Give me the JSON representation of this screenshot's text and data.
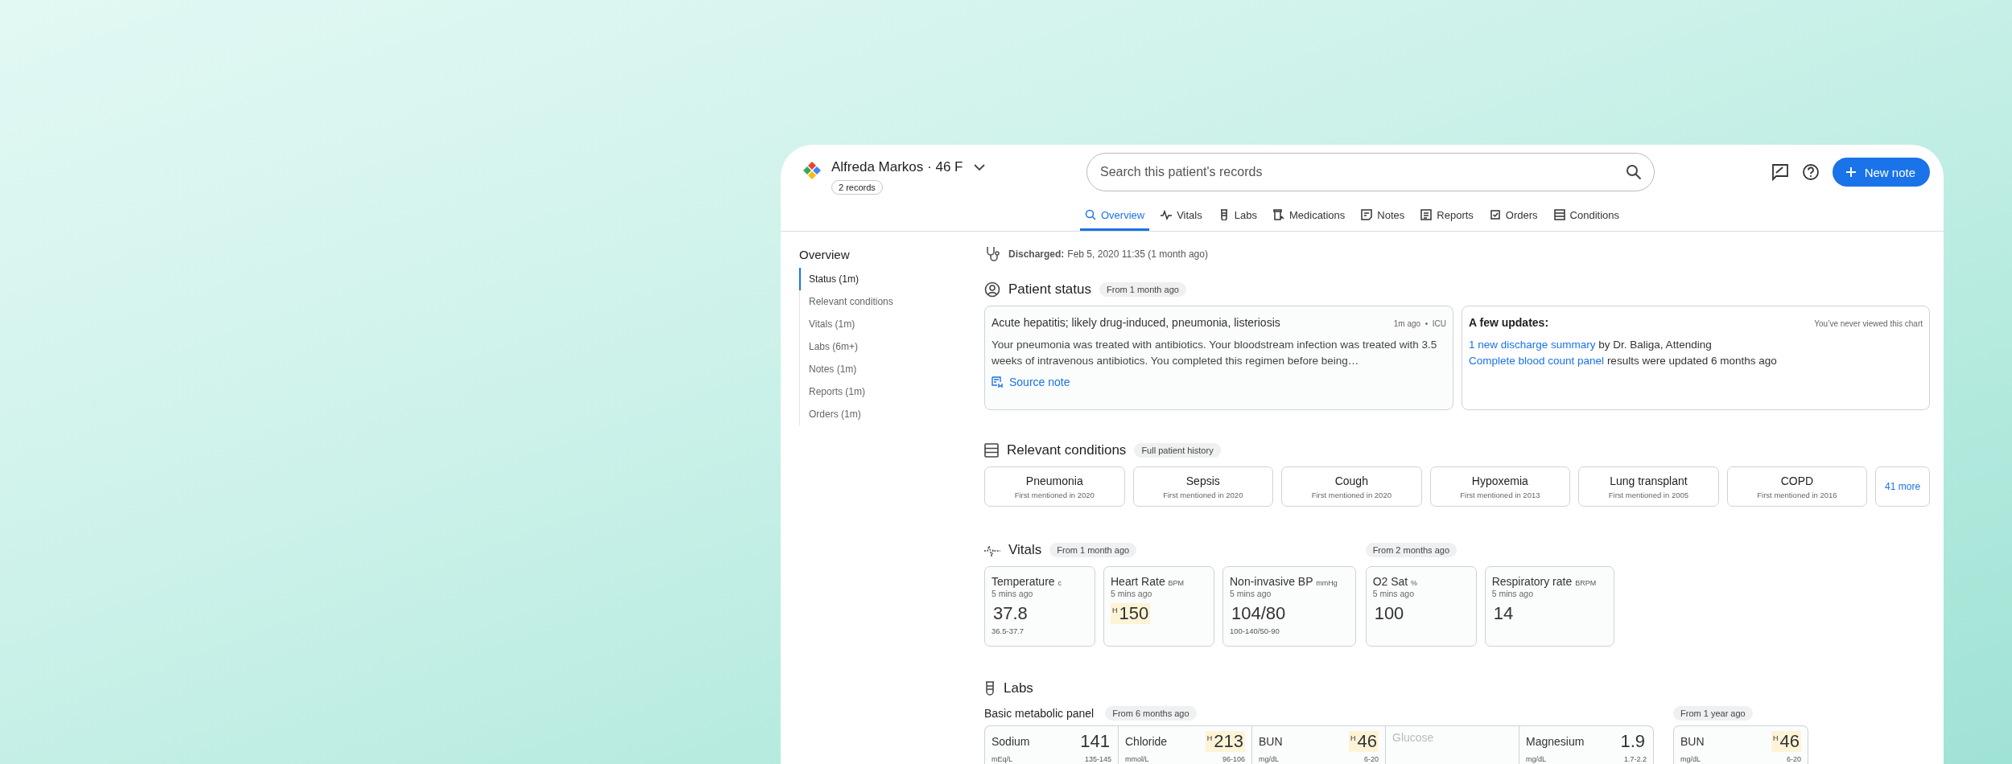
{
  "header": {
    "patient_name": "Alfreda Markos · 46 F",
    "records_badge": "2 records",
    "search": {
      "placeholder": "Search this patient's records"
    },
    "new_note_button": "New note"
  },
  "tabs": [
    {
      "label": "Overview",
      "selected": true
    },
    {
      "label": "Vitals",
      "selected": false
    },
    {
      "label": "Labs",
      "selected": false
    },
    {
      "label": "Medications",
      "selected": false
    },
    {
      "label": "Notes",
      "selected": false
    },
    {
      "label": "Reports",
      "selected": false
    },
    {
      "label": "Orders",
      "selected": false
    },
    {
      "label": "Conditions",
      "selected": false
    }
  ],
  "sidebar": {
    "title": "Overview",
    "items": [
      {
        "label": "Status (1m)",
        "selected": true
      },
      {
        "label": "Relevant conditions",
        "selected": false
      },
      {
        "label": "Vitals (1m)",
        "selected": false
      },
      {
        "label": "Labs (6m+)",
        "selected": false
      },
      {
        "label": "Notes (1m)",
        "selected": false
      },
      {
        "label": "Reports (1m)",
        "selected": false
      },
      {
        "label": "Orders (1m)",
        "selected": false
      }
    ]
  },
  "discharge": {
    "label": "Discharged:",
    "value": "Feb 5, 2020 11:35 (1 month ago)"
  },
  "patient_status": {
    "title": "Patient status",
    "badge": "From 1 month ago",
    "summary_card": {
      "title": "Acute hepatitis; likely drug-induced, pneumonia, listeriosis",
      "meta": "1m ago  •  ICU",
      "body": "Your pneumonia was treated with antibiotics. Your bloodstream infection was treated with 3.5 weeks of intravenous antibiotics. You completed this regimen before being…",
      "link": "Source note"
    },
    "updates_card": {
      "title": "A few updates:",
      "note": "You’ve never viewed this chart",
      "updates": [
        {
          "link": "1 new discharge summary",
          "text": "by Dr. Baliga, Attending"
        },
        {
          "link": "Complete blood count panel",
          "text": "results were updated 6 months ago"
        }
      ]
    }
  },
  "conditions": {
    "title": "Relevant conditions",
    "badge": "Full patient history",
    "items": [
      {
        "name": "Pneumonia",
        "first": "First mentioned in 2020"
      },
      {
        "name": "Sepsis",
        "first": "First mentioned in 2020"
      },
      {
        "name": "Cough",
        "first": "First mentioned in 2020"
      },
      {
        "name": "Hypoxemia",
        "first": "First mentioned in 2013"
      },
      {
        "name": "Lung transplant",
        "first": "First mentioned in 2005"
      },
      {
        "name": "COPD",
        "first": "First mentioned in 2016"
      }
    ],
    "more": "41 more"
  },
  "vitals": {
    "title": "Vitals",
    "groups": [
      {
        "badge": "From 1 month ago",
        "cards": [
          {
            "name": "Temperature",
            "unit": "c",
            "time": "5 mins ago",
            "value": "37.8",
            "range": "36.5-37.7"
          },
          {
            "name": "Heart Rate",
            "unit": "BPM",
            "time": "5 mins ago",
            "value": "150",
            "flag": "H"
          },
          {
            "name": "Non-invasive BP",
            "unit": "mmHg",
            "time": "5 mins ago",
            "value": "104/80",
            "range": "100-140/50-90"
          }
        ]
      },
      {
        "badge": "From 2 months ago",
        "cards": [
          {
            "name": "O2 Sat",
            "unit": "%",
            "time": "5 mins ago",
            "value": "100"
          },
          {
            "name": "Respiratory rate",
            "unit": "BRPM",
            "time": "5 mins ago",
            "value": "14"
          }
        ]
      }
    ]
  },
  "labs": {
    "title": "Labs",
    "panels": [
      {
        "title": "Basic metabolic panel",
        "badge": "From 6 months ago",
        "items": [
          {
            "name": "Sodium",
            "value": "141",
            "unit": "mEq/L",
            "range": "135-145",
            "disabled": false
          },
          {
            "name": "Chloride",
            "value": "213",
            "flag": "H",
            "unit": "mmol/L",
            "range": "96-106",
            "disabled": false
          },
          {
            "name": "BUN",
            "value": "46",
            "flag": "H",
            "unit": "mg/dL",
            "range": "6-20",
            "disabled": false
          },
          {
            "name": "Glucose",
            "disabled": true
          },
          {
            "name": "Magnesium",
            "value": "1.9",
            "unit": "mg/dL",
            "range": "1.7-2.2",
            "disabled": false
          }
        ]
      },
      {
        "badge": "From 1 year ago",
        "items": [
          {
            "name": "BUN",
            "value": "46",
            "flag": "H",
            "unit": "mg/dL",
            "range": "6-20",
            "disabled": false
          }
        ]
      }
    ]
  }
}
